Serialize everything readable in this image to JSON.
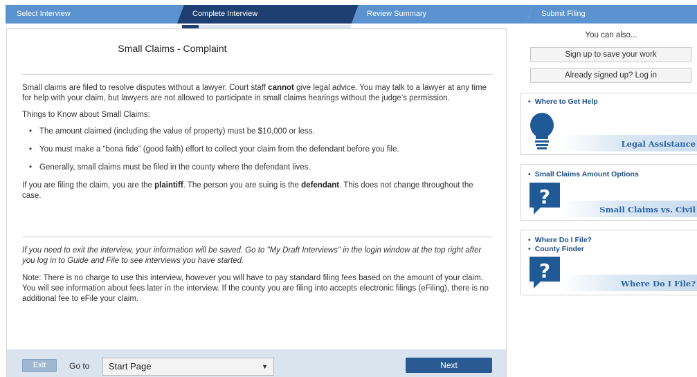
{
  "steps": [
    "Select Interview",
    "Complete Interview",
    "Review Summary",
    "Submit Filing"
  ],
  "progress": 0.1,
  "main": {
    "title": "Small Claims - Complaint",
    "intro_pre": "Small claims are filed to resolve disputes without a lawyer. Court staff ",
    "intro_bold": "cannot",
    "intro_post": " give legal advice. You may talk to a lawyer at any time for help with your claim, but lawyers are not allowed to participate in small claims hearings without the judge’s permission.",
    "things_heading": "Things to Know about Small Claims:",
    "bullets": [
      "The amount claimed (including the value of property) must be $10,000 or less.",
      "You must make a “bona fide” (good faith) effort to collect your claim from the defendant before you file.",
      "Generally, small claims must be filed in the county where the defendant lives."
    ],
    "plaintiff_pre": "If you are filing the claim, you are the ",
    "plaintiff_bold": "plaintiff",
    "plaintiff_mid": ". The person you are suing is the ",
    "defendant_bold": "defendant",
    "plaintiff_post": ". This does not change throughout the case.",
    "exit_note": "If you need to exit the interview, your information will be saved. Go to \"My Draft Interviews\" in the login window at the top right after you log in to Guide and File to see interviews you have started.",
    "fee_note": "Note: There is no charge to use this interview, however you will have to pay standard filing fees based on the amount of your claim. You will see information about fees later in the interview. If the county you are filing into accepts electronic filings (eFiling), there is no additional fee to eFile your claim."
  },
  "footer": {
    "exit_label": "Exit",
    "goto_label": "Go to",
    "goto_selected": "Start Page",
    "next_label": "Next"
  },
  "sidebar": {
    "title": "You can also...",
    "signup_label": "Sign up to save your work",
    "login_label": "Already signed up? Log in",
    "cards": [
      {
        "links": [
          "Where to Get Help"
        ],
        "footer": "Legal Assistance",
        "icon": "lightbulb-icon"
      },
      {
        "links": [
          "Small Claims Amount Options"
        ],
        "footer": "Small Claims vs. Civil",
        "icon": "question-icon"
      },
      {
        "links": [
          "Where Do I File?",
          "County Finder"
        ],
        "footer": "Where Do I File?",
        "icon": "question-icon"
      }
    ]
  },
  "colors": {
    "step_active": "#1d3f72",
    "step_inactive": "#5a93cf",
    "next_button": "#2a5a92",
    "link": "#1f4d86",
    "footer_bg": "#d9e4ef"
  }
}
